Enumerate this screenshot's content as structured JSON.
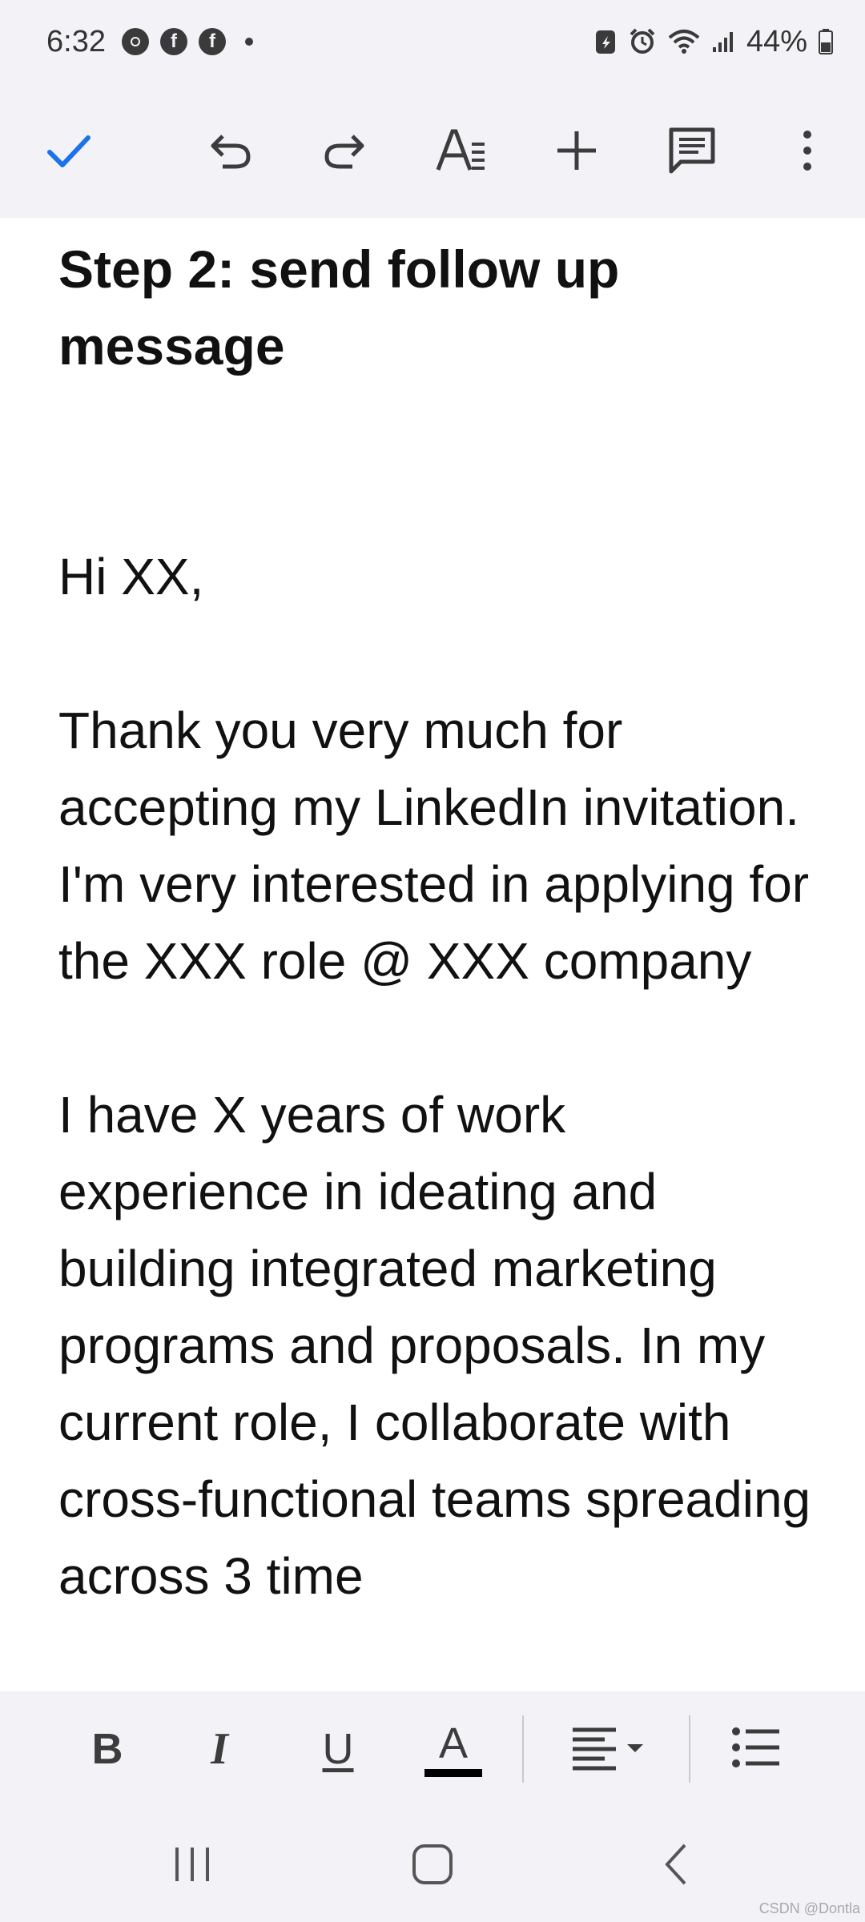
{
  "status_bar": {
    "time": "6:32",
    "battery": "44%",
    "icons": [
      "chrome-icon",
      "facebook-icon",
      "facebook-icon",
      "notification-dot-icon",
      "battery-saver-icon",
      "alarm-icon",
      "wifi-icon",
      "signal-icon",
      "battery-icon"
    ]
  },
  "toolbar": {
    "icons": [
      "check-icon",
      "undo-icon",
      "redo-icon",
      "text-format-icon",
      "insert-icon",
      "comment-icon",
      "more-icon"
    ],
    "accent_color": "#1a73e8"
  },
  "document": {
    "heading": "Step 2: send follow up message",
    "paragraphs": [
      "Hi XX,",
      "Thank you very much for accepting my LinkedIn invitation. I'm very interested in applying for the XXX role @ XXX company",
      "I have X years of work experience in ideating and building integrated marketing programs and proposals. In my current role, I collaborate with cross-functional teams spreading across 3 time"
    ]
  },
  "format_bar": {
    "bold": "B",
    "italic": "I",
    "underline": "U",
    "text_color": "A",
    "icons": [
      "bold-icon",
      "italic-icon",
      "underline-icon",
      "text-color-icon",
      "align-icon",
      "bullet-list-icon"
    ]
  },
  "navigation_bar": {
    "icons": [
      "recents-icon",
      "home-icon",
      "back-icon"
    ]
  },
  "watermark": "CSDN @Dontla"
}
